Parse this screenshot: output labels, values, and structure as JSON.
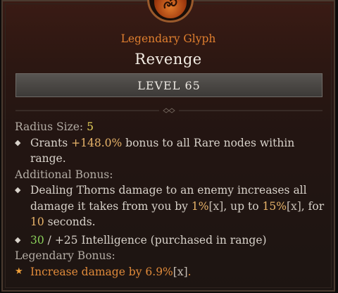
{
  "header": {
    "subtitle": "Legendary Glyph",
    "title": "Revenge",
    "level": "LEVEL 65"
  },
  "radius": {
    "label": "Radius Size:",
    "value": "5"
  },
  "grant": {
    "pre": "Grants ",
    "value": "+148.0%",
    "post": " bonus to all Rare nodes within range."
  },
  "additional": {
    "label": "Additional Bonus:",
    "line1": "Dealing Thorns damage to an enemy increases all damage it takes from you by ",
    "pct1": "1%",
    "x1": "[x]",
    "mid": ", up to ",
    "pct2": "15%",
    "x2": "[x]",
    "mid2": ", for ",
    "seconds": "10",
    "end": " seconds."
  },
  "stat": {
    "current": "30",
    "sep": " / ",
    "rest": "+25 Intelligence (purchased in range)"
  },
  "legendary": {
    "label": "Legendary Bonus:",
    "text": "Increase damage by ",
    "value": "6.9%",
    "x": "[x]",
    "end": "."
  },
  "colors": {
    "legendary": "#e08a3a",
    "value": "#e6d25a",
    "green": "#8ad05a"
  },
  "icons": {
    "emblem": "glyph-emblem-icon",
    "bullet": "diamond-bullet-icon",
    "star": "star-bullet-icon"
  }
}
